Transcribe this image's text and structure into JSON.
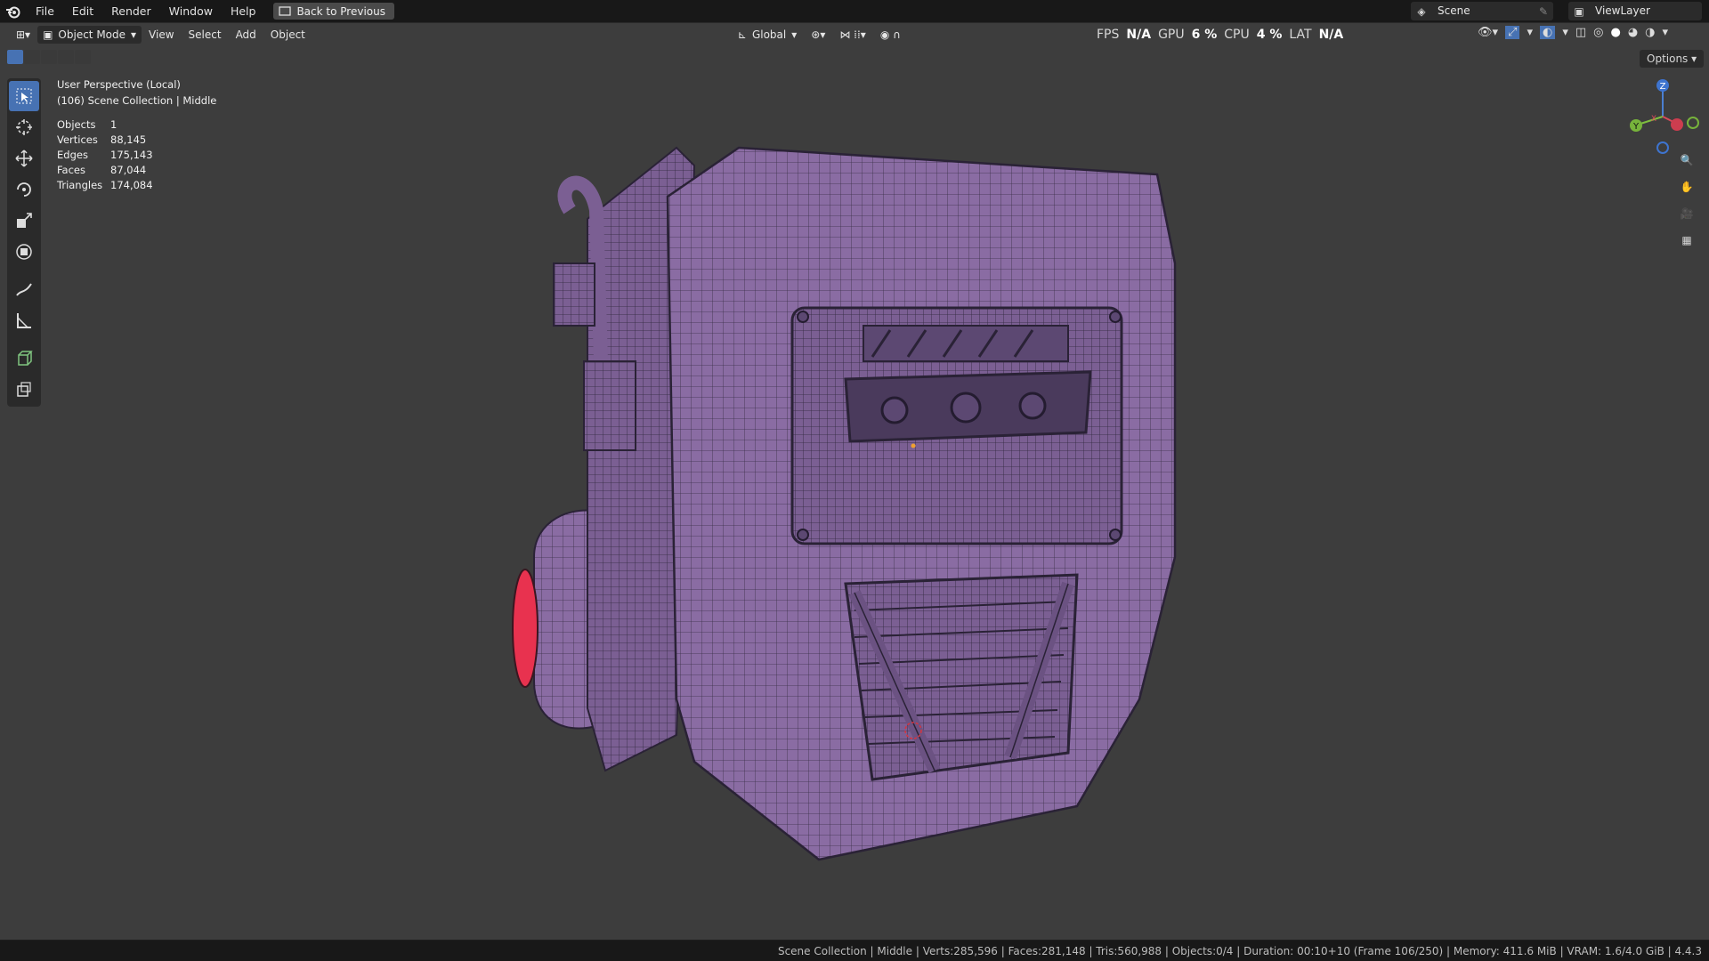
{
  "menu": {
    "file": "File",
    "edit": "Edit",
    "render": "Render",
    "window": "Window",
    "help": "Help"
  },
  "back_button": "Back to Previous",
  "scene_name": "Scene",
  "view_layer": "ViewLayer",
  "header": {
    "mode": "Object Mode",
    "view": "View",
    "select": "Select",
    "add": "Add",
    "object": "Object",
    "transform_orientation": "Global"
  },
  "perf": {
    "fps_label": "FPS",
    "fps_value": "N/A",
    "gpu_label": "GPU",
    "gpu_value": "6 %",
    "cpu_label": "CPU",
    "cpu_value": "4 %",
    "lat_label": "LAT",
    "lat_value": "N/A"
  },
  "options_label": "Options",
  "viewport": {
    "perspective": "User Perspective (Local)",
    "collection": "(106) Scene Collection | Middle"
  },
  "stats": [
    {
      "key": "Objects",
      "value": "1"
    },
    {
      "key": "Vertices",
      "value": "88,145"
    },
    {
      "key": "Edges",
      "value": "175,143"
    },
    {
      "key": "Faces",
      "value": "87,044"
    },
    {
      "key": "Triangles",
      "value": "174,084"
    }
  ],
  "gizmo": {
    "x": "X",
    "y": "Y",
    "z": "Z"
  },
  "statusbar": "Scene Collection | Middle | Verts:285,596 | Faces:281,148 | Tris:560,988 | Objects:0/4 | Duration: 00:10+10 (Frame 106/250) | Memory: 411.6 MiB | VRAM: 1.6/4.0 GiB | 4.4.3",
  "colors": {
    "mesh": "#8d6fa6",
    "wire": "#2a2236",
    "red": "#e8324f",
    "accent": "#4772b3"
  },
  "icons": [
    "blender-logo",
    "cursor-icon",
    "move-icon",
    "rotate-icon",
    "scale-icon",
    "transform-icon",
    "annotate-icon",
    "measure-icon",
    "add-cube-icon",
    "extrude-icon",
    "zoom-icon",
    "hand-icon",
    "camera-icon",
    "grid-icon"
  ]
}
